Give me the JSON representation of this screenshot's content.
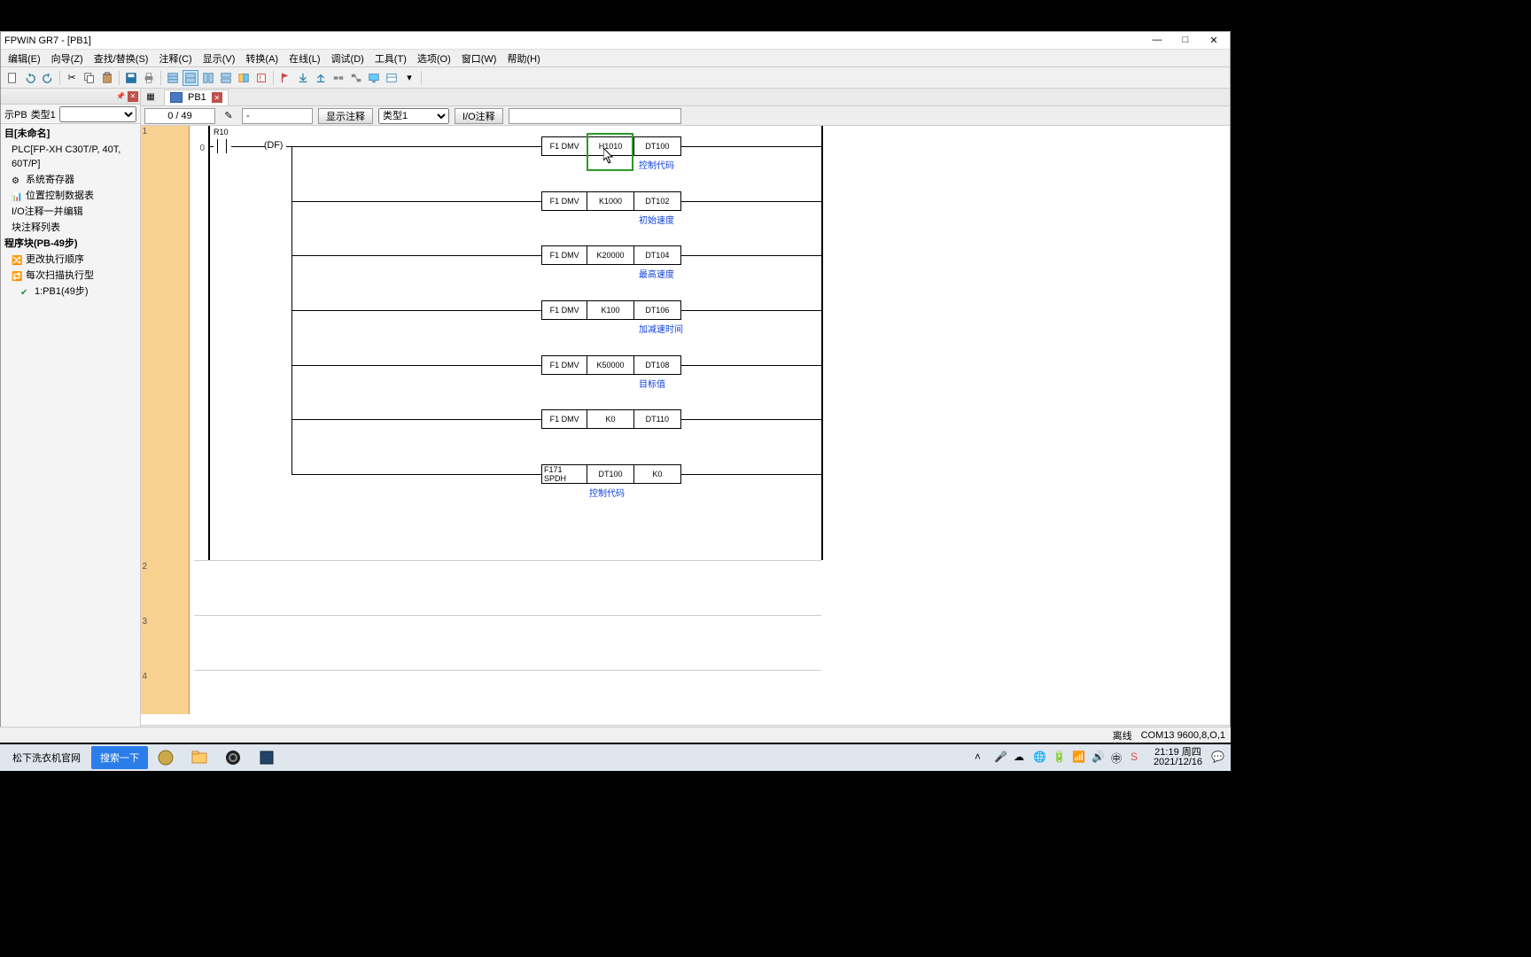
{
  "titlebar": {
    "title": "FPWIN GR7 - [PB1]"
  },
  "menubar": [
    "编辑(E)",
    "向导(Z)",
    "查找/替换(S)",
    "注释(C)",
    "显示(V)",
    "转换(A)",
    "在线(L)",
    "调试(D)",
    "工具(T)",
    "选项(O)",
    "窗口(W)",
    "帮助(H)"
  ],
  "side": {
    "show_label": "示PB",
    "type_label": "类型1",
    "proj_title": "目[未命名]",
    "plc_model": "PLC[FP-XH C30T/P, 40T, 60T/P]",
    "nodes": [
      {
        "text": "系统寄存器",
        "icon": "gear"
      },
      {
        "text": "位置控制数据表",
        "icon": "pos"
      },
      {
        "text": "I/O注释一并编辑",
        "icon": ""
      },
      {
        "text": "块注释列表",
        "icon": ""
      }
    ],
    "prog_block": "程序块(PB-49步)",
    "sub_nodes": [
      {
        "text": "更改执行顺序",
        "icon": "order"
      },
      {
        "text": "每次扫描执行型",
        "icon": "scan"
      },
      {
        "text": "1:PB1(49步)",
        "icon": "check",
        "indent": 2
      }
    ]
  },
  "tab": {
    "label": "PB1"
  },
  "toolrow2": {
    "counter": "0 /    49",
    "dash": "-",
    "btn_comment": "显示注释",
    "type_sel": "类型1",
    "io_label": "I/O注释"
  },
  "ladder": {
    "rung_nums": [
      "1",
      "2",
      "3",
      "4"
    ],
    "step_label": "0",
    "contact_label": "R10",
    "df_label": "DF",
    "rows": [
      {
        "cells": [
          "F1 DMV",
          "H1010",
          "DT100"
        ],
        "comment": "控制代码"
      },
      {
        "cells": [
          "F1 DMV",
          "K1000",
          "DT102"
        ],
        "comment": "初始速度"
      },
      {
        "cells": [
          "F1 DMV",
          "K20000",
          "DT104"
        ],
        "comment": "最高速度"
      },
      {
        "cells": [
          "F1 DMV",
          "K100",
          "DT106"
        ],
        "comment": "加减速时间"
      },
      {
        "cells": [
          "F1 DMV",
          "K50000",
          "DT108"
        ],
        "comment": "目标值"
      },
      {
        "cells": [
          "F1 DMV",
          "K0",
          "DT110"
        ],
        "comment": ""
      },
      {
        "cells": [
          "F171 SPDH",
          "DT100",
          "K0"
        ],
        "comment": "控制代码",
        "comment_pos": "mid"
      }
    ]
  },
  "statusbar": {
    "offline": "离线",
    "com": "COM13 9600,8,O,1"
  },
  "taskbar": {
    "items": [
      {
        "text": "松下洗衣机官网",
        "active": false
      },
      {
        "text": "搜索一下",
        "active": true
      }
    ]
  },
  "systray": {
    "time": "21:19 周四",
    "date": "2021/12/16"
  }
}
